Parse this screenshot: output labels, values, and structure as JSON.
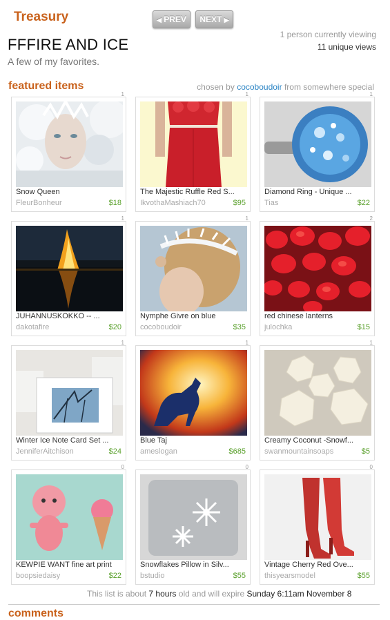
{
  "header": {
    "brand": "Treasury",
    "prev_label": "PREV",
    "next_label": "NEXT",
    "prev_icon": "triangle-left-icon",
    "next_icon": "triangle-right-icon",
    "title": "FFFIRE AND ICE",
    "subtitle": "A few of my favorites.",
    "viewing": "1 person currently viewing",
    "views": "11 unique views"
  },
  "featured": {
    "heading": "featured items",
    "chosen_prefix": "chosen by",
    "curator": "cocoboudoir",
    "from_prefix": "from",
    "location": "somewhere special"
  },
  "items": [
    {
      "title": "Snow Queen",
      "shop": "FleurBonheur",
      "price": "$18",
      "corner": "1"
    },
    {
      "title": "The Majestic Ruffle Red S...",
      "shop": "IkvothaMashiach70",
      "price": "$95",
      "corner": "1"
    },
    {
      "title": "Diamond Ring - Unique ...",
      "shop": "Tias",
      "price": "$22",
      "corner": "1"
    },
    {
      "title": "JUHANNUSKOKKO -- ...",
      "shop": "dakotafire",
      "price": "$20",
      "corner": "1"
    },
    {
      "title": "Nymphe Givre on blue",
      "shop": "cocoboudoir",
      "price": "$35",
      "corner": "1"
    },
    {
      "title": "red chinese lanterns",
      "shop": "julochka",
      "price": "$15",
      "corner": "2"
    },
    {
      "title": "Winter Ice Note Card Set ...",
      "shop": "JenniferAitchison",
      "price": "$24",
      "corner": "1"
    },
    {
      "title": "Blue Taj",
      "shop": "ameslogan",
      "price": "$685",
      "corner": "1"
    },
    {
      "title": "Creamy Coconut -Snowf...",
      "shop": "swanmountainsoaps",
      "price": "$5",
      "corner": "1"
    },
    {
      "title": "KEWPIE WANT fine art print",
      "shop": "boopsiedaisy",
      "price": "$22",
      "corner": "0"
    },
    {
      "title": "Snowflakes Pillow in Silv...",
      "shop": "bstudio",
      "price": "$55",
      "corner": "0"
    },
    {
      "title": "Vintage Cherry Red Ove...",
      "shop": "thisyearsmodel",
      "price": "$55",
      "corner": "0"
    }
  ],
  "footer": {
    "prefix": "This list is about",
    "age": "7 hours",
    "middle": "old and will expire",
    "expire": "Sunday 6:11am  November 8"
  },
  "comments_heading": "comments"
}
